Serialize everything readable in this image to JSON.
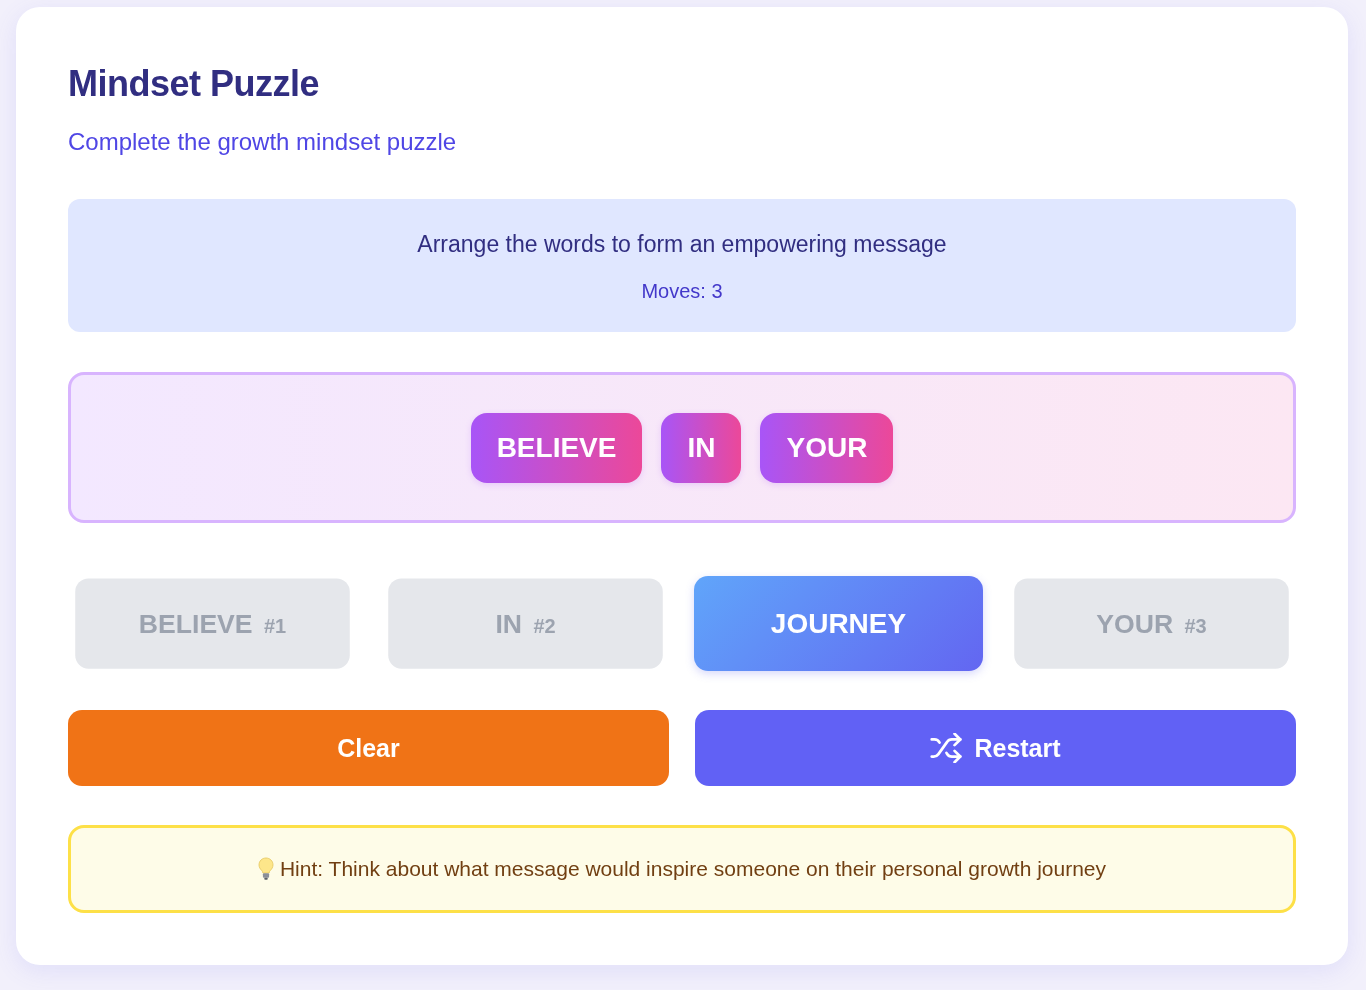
{
  "title": "Mindset Puzzle",
  "subtitle": "Complete the growth mindset puzzle",
  "instructions": {
    "text": "Arrange the words to form an empowering message",
    "moves": "Moves: 3"
  },
  "answer": {
    "words": [
      "BELIEVE",
      "IN",
      "YOUR"
    ]
  },
  "word_tiles": [
    {
      "word": "BELIEVE",
      "used": true,
      "order": "#1"
    },
    {
      "word": "IN",
      "used": true,
      "order": "#2"
    },
    {
      "word": "JOURNEY",
      "used": false
    },
    {
      "word": "YOUR",
      "used": true,
      "order": "#3"
    }
  ],
  "buttons": [
    {
      "kind": "clear",
      "label": "Clear"
    },
    {
      "kind": "restart",
      "label": "Restart"
    }
  ],
  "hint": "Hint: Think about what message would inspire someone on their personal growth journey"
}
